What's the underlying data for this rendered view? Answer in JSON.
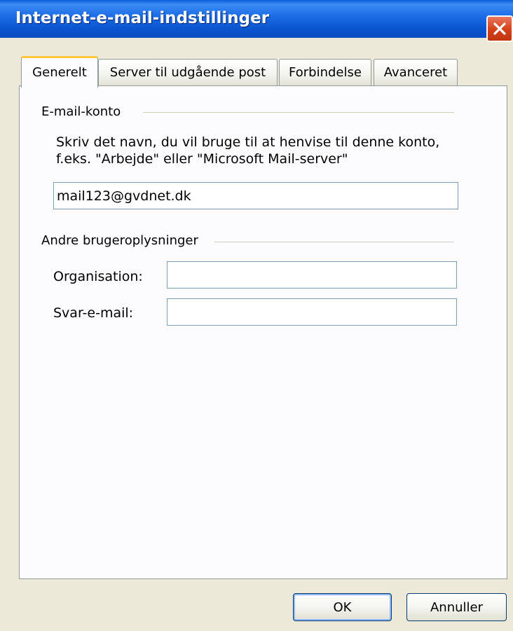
{
  "window": {
    "title": "Internet-e-mail-indstillinger"
  },
  "tabs": [
    {
      "label": "Generelt",
      "active": true
    },
    {
      "label": "Server til udgående post",
      "active": false
    },
    {
      "label": "Forbindelse",
      "active": false
    },
    {
      "label": "Avanceret",
      "active": false
    }
  ],
  "email_account": {
    "title": "E-mail-konto",
    "description_line1": "Skriv det navn, du vil bruge til at henvise til denne konto,",
    "description_line2": "f.eks. \"Arbejde\" eller \"Microsoft Mail-server\"",
    "account_name_value": "mail123@gvdnet.dk"
  },
  "user_info": {
    "title": "Andre brugeroplysninger",
    "organisation_label": "Organisation:",
    "organisation_value": "",
    "reply_email_label": "Svar-e-mail:",
    "reply_email_value": ""
  },
  "buttons": {
    "ok_label": "OK",
    "cancel_label": "Annuller"
  }
}
